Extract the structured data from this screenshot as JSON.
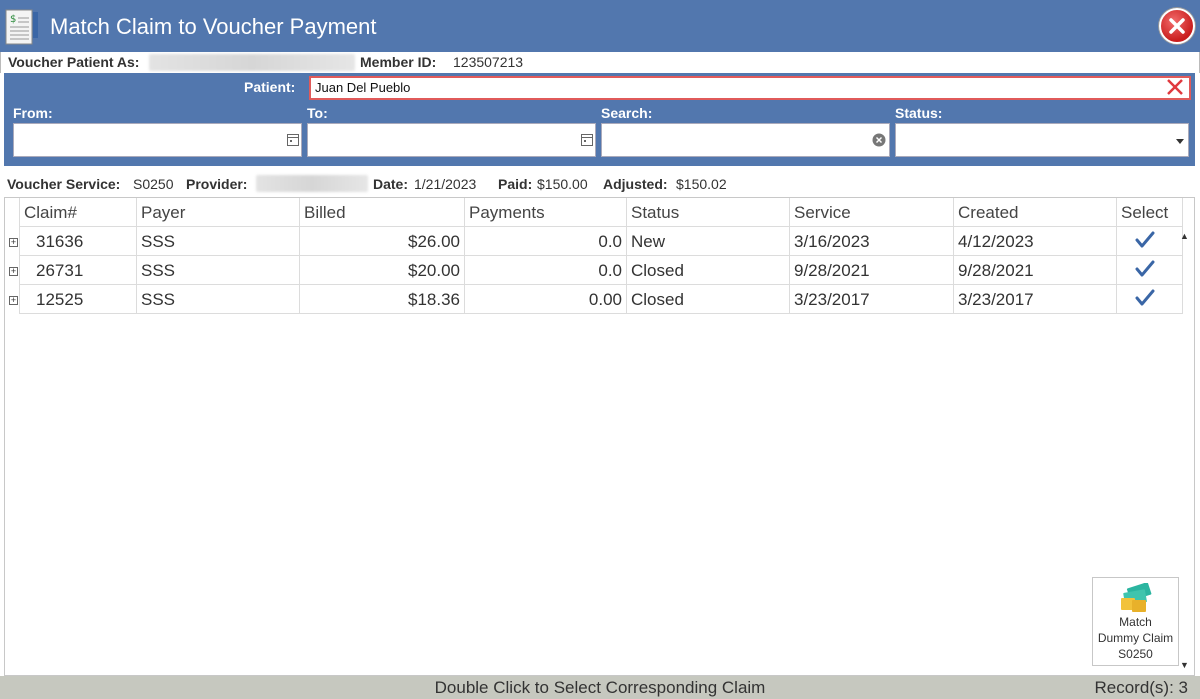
{
  "window": {
    "title": "Match Claim to Voucher Payment"
  },
  "voucher": {
    "patient_as_label": "Voucher Patient As:",
    "member_id_label": "Member ID:",
    "member_id": "123507213"
  },
  "filters": {
    "patient_label": "Patient:",
    "patient_value": "Juan Del Pueblo",
    "from_label": "From:",
    "to_label": "To:",
    "search_label": "Search:",
    "status_label": "Status:"
  },
  "service": {
    "service_label": "Voucher Service:",
    "service_value": "S0250",
    "provider_label": "Provider:",
    "date_label": "Date:",
    "date_value": "1/21/2023",
    "paid_label": "Paid:",
    "paid_value": "$150.00",
    "adjusted_label": "Adjusted:",
    "adjusted_value": "$150.02"
  },
  "grid": {
    "headers": [
      "Claim#",
      "Payer",
      "Billed",
      "Payments",
      "Status",
      "Service",
      "Created",
      "Select"
    ],
    "rows": [
      {
        "claim": "31636",
        "payer": "SSS",
        "billed": "$26.00",
        "payments": "0.0",
        "status": "New",
        "service": "3/16/2023",
        "created": "4/12/2023"
      },
      {
        "claim": "26731",
        "payer": "SSS",
        "billed": "$20.00",
        "payments": "0.0",
        "status": "Closed",
        "service": "9/28/2021",
        "created": "9/28/2021"
      },
      {
        "claim": "12525",
        "payer": "SSS",
        "billed": "$18.36",
        "payments": "0.00",
        "status": "Closed",
        "service": "3/23/2017",
        "created": "3/23/2017"
      }
    ]
  },
  "dummy_button": {
    "line1": "Match",
    "line2": "Dummy Claim",
    "line3": "S0250"
  },
  "statusbar": {
    "hint": "Double Click to Select Corresponding Claim",
    "records": "Record(s): 3"
  },
  "colors": {
    "header_blue": "#5277ae",
    "check_blue": "#3a66a6",
    "close_red": "#d42a2a"
  }
}
